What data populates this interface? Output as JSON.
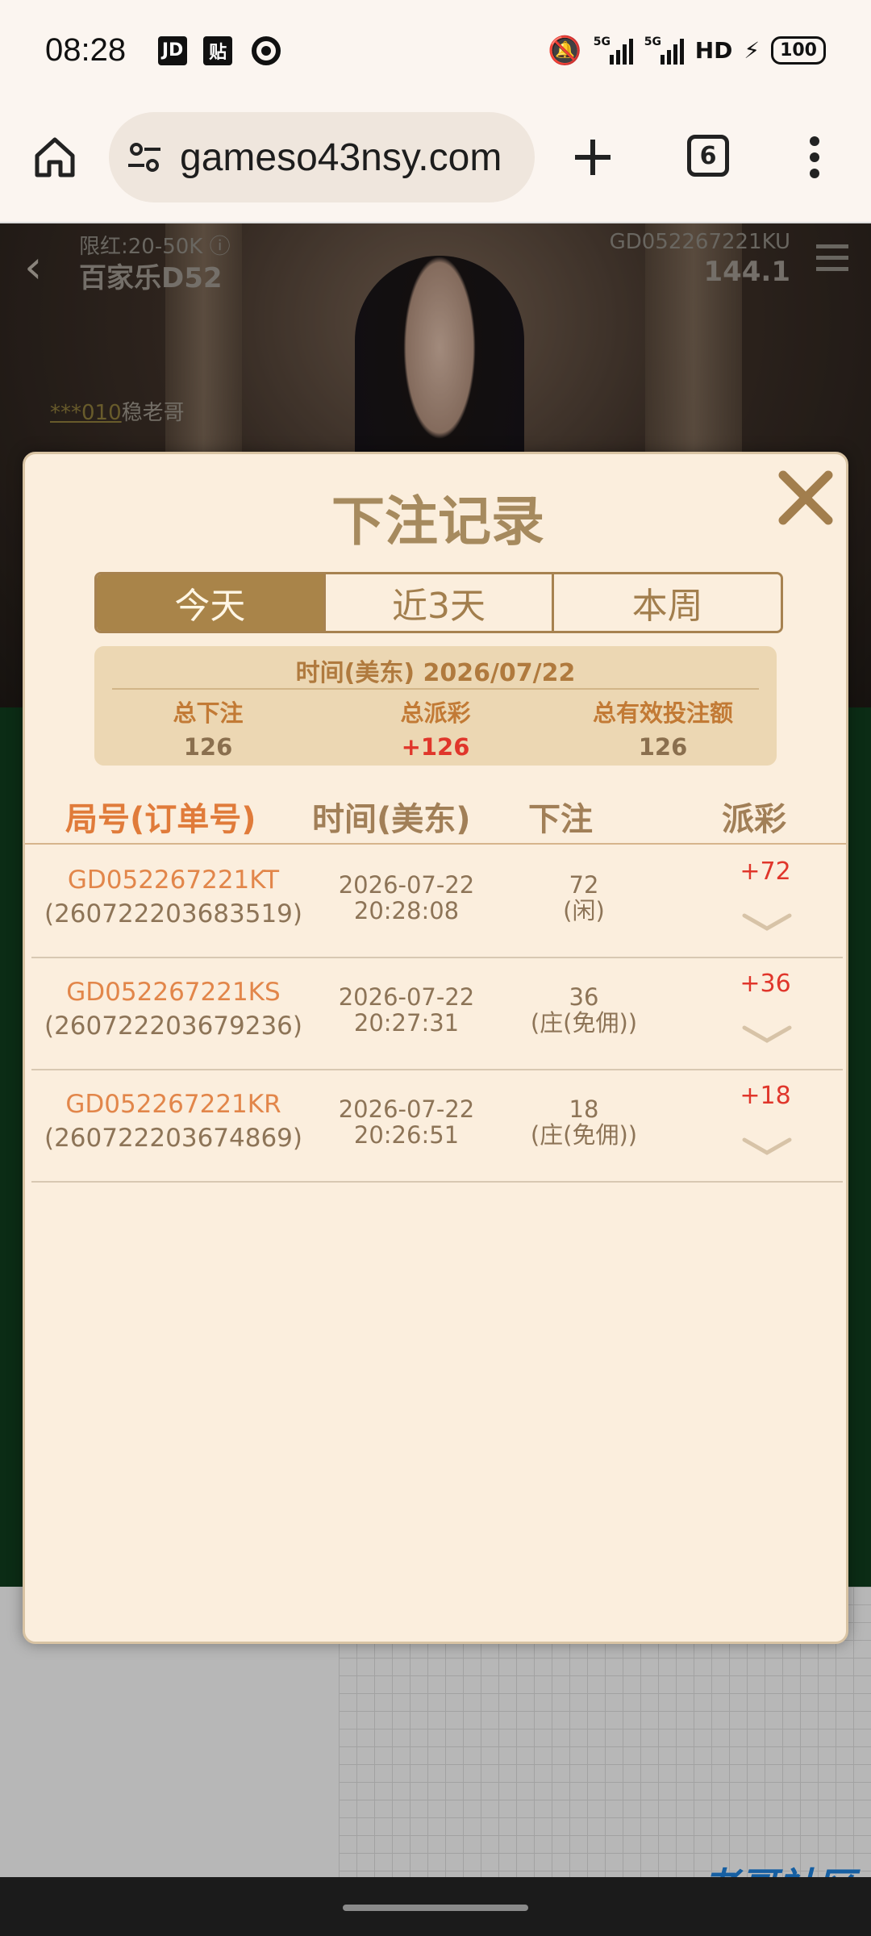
{
  "status_bar": {
    "time": "08:28",
    "app_icons": [
      "JD",
      "贴"
    ],
    "signal1": "5G",
    "signal2": "5G",
    "hd": "HD",
    "battery": "100"
  },
  "browser": {
    "url": "gameso43nsy.com",
    "tab_count": "6"
  },
  "game": {
    "limit": "限红:20-50K ⓘ",
    "table_name": "百家乐D52",
    "round_id": "GD052267221KU",
    "balance": "144.1",
    "chat_user": "***010",
    "chat_text": "稳老哥"
  },
  "modal": {
    "title": "下注记录",
    "tabs": [
      {
        "label": "今天",
        "active": true
      },
      {
        "label": "近3天",
        "active": false
      },
      {
        "label": "本周",
        "active": false
      }
    ],
    "summary": {
      "date_line": "时间(美东) 2026/07/22",
      "total_bet_label": "总下注",
      "total_bet": "126",
      "total_payout_label": "总派彩",
      "total_payout": "+126",
      "valid_bet_label": "总有效投注额",
      "valid_bet": "126"
    },
    "columns": {
      "round": "局号(订单号)",
      "time": "时间(美东)",
      "bet": "下注",
      "payout": "派彩"
    },
    "rows": [
      {
        "round_id": "GD052267221KT",
        "order_no": "(260722203683519)",
        "date": "2026-07-22",
        "time": "20:28:08",
        "amount": "72",
        "side": "(闲)",
        "payout": "+72"
      },
      {
        "round_id": "GD052267221KS",
        "order_no": "(260722203679236)",
        "date": "2026-07-22",
        "time": "20:27:31",
        "amount": "36",
        "side": "(庄(免佣))",
        "payout": "+36"
      },
      {
        "round_id": "GD052267221KR",
        "order_no": "(260722203674869)",
        "date": "2026-07-22",
        "time": "20:26:51",
        "amount": "18",
        "side": "(庄(免佣))",
        "payout": "+18"
      }
    ]
  },
  "watermark": "老哥社区",
  "colors": {
    "accent_gold": "#a98449",
    "payout_red": "#e0362b",
    "round_orange": "#e2864a",
    "modal_bg": "#fbeedd"
  }
}
